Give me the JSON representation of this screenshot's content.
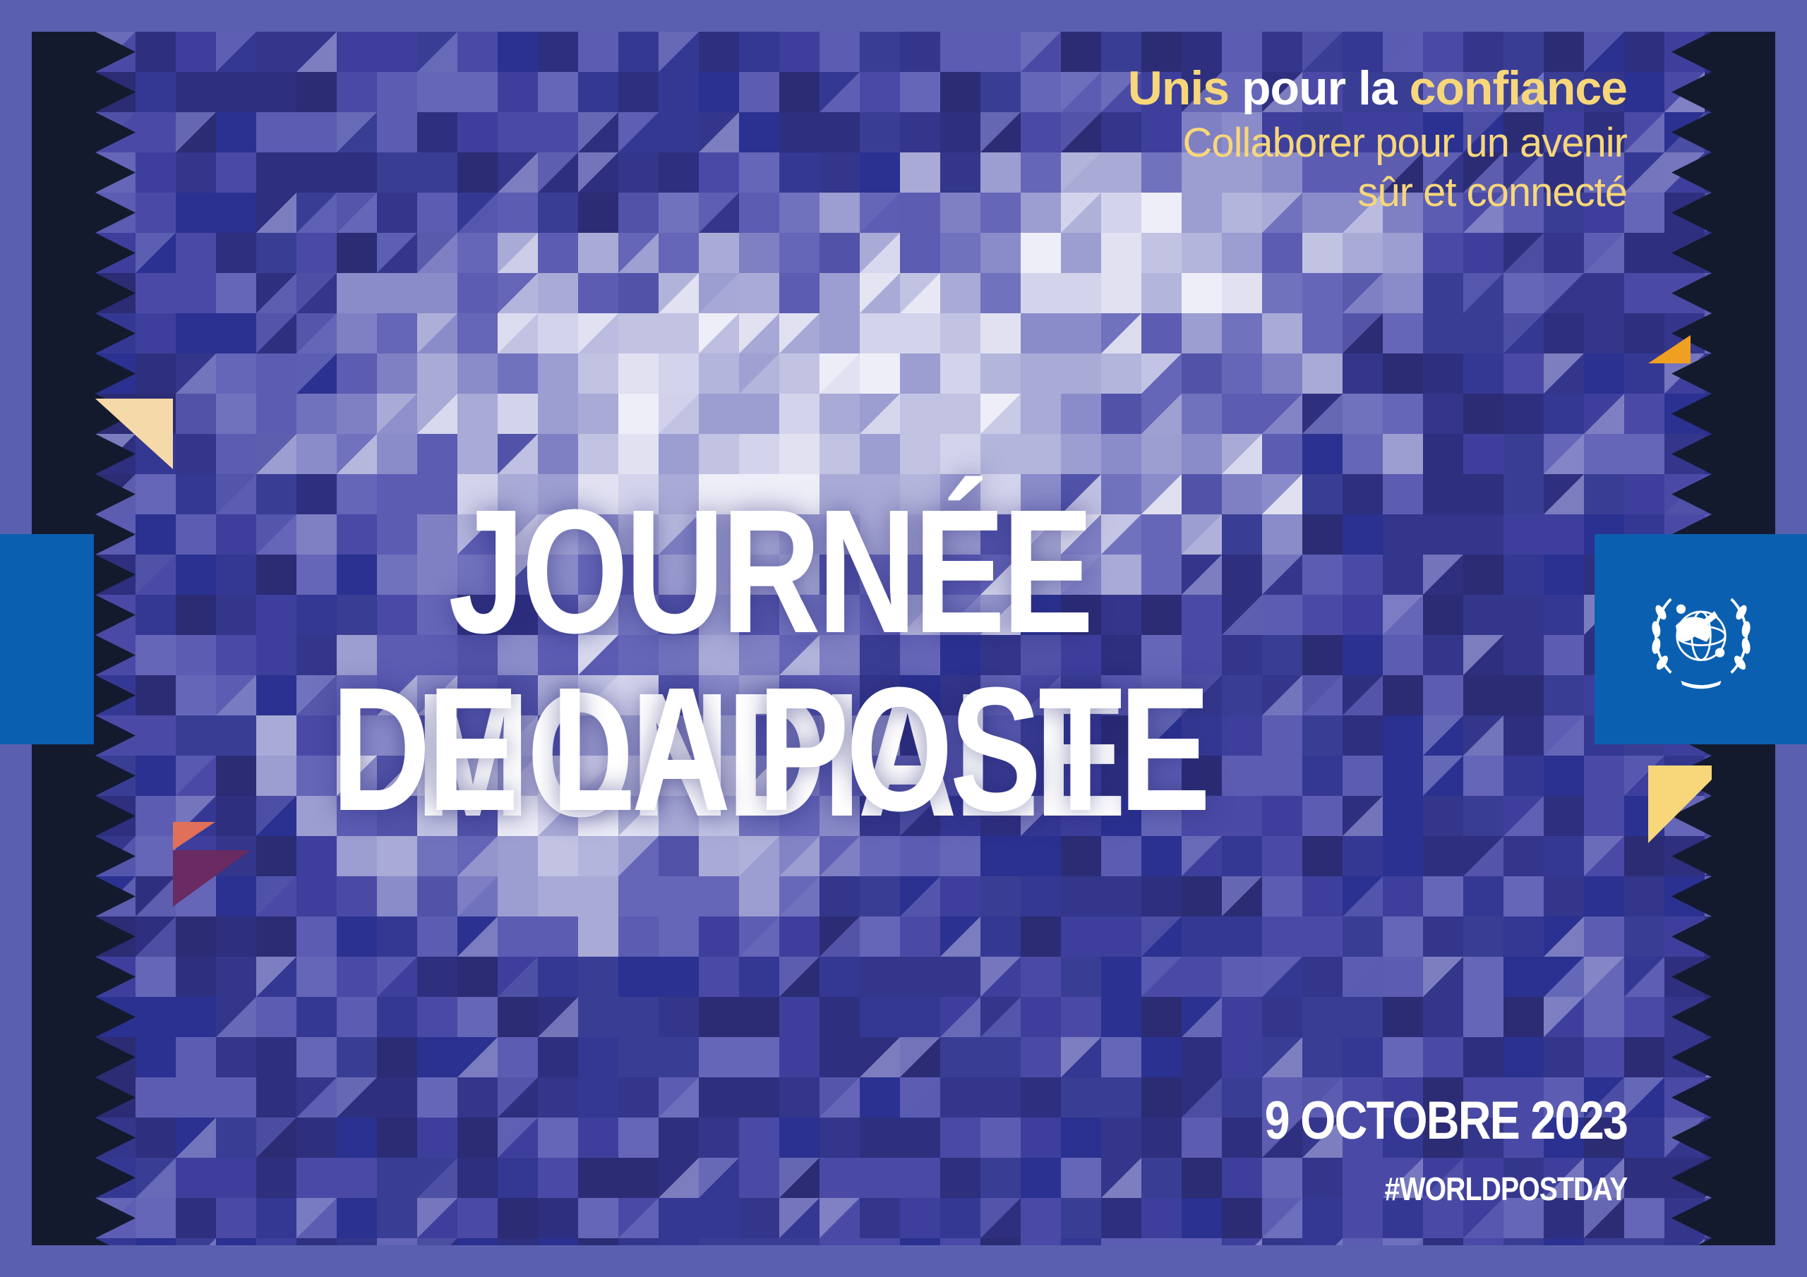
{
  "colors": {
    "background_border": "#5a5fb0",
    "frame_dark": "#141a2e",
    "accent_blue": "#0b5fb0",
    "accent_yellow": "#f7d77a",
    "text_white": "#ffffff"
  },
  "tagline": {
    "word1": "Unis",
    "word2": " pour la ",
    "word3": "confiance",
    "sub1": "Collaborer pour un avenir",
    "sub2": "sûr et connecté"
  },
  "title": {
    "line1": "JOURNÉE MONDIALE",
    "line2": "DE LA POSTE"
  },
  "date": "9 OCTOBRE 2023",
  "hashtag": "#WORLDPOSTDAY",
  "logo": {
    "icon": "upu-emblem-icon"
  }
}
